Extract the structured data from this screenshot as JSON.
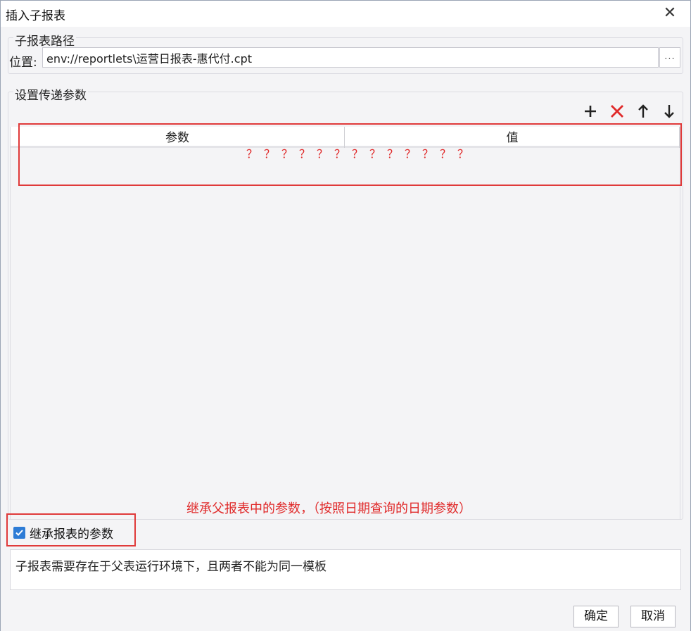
{
  "window": {
    "title": "插入子报表",
    "close_glyph": "✕"
  },
  "path_group": {
    "legend": "子报表路径",
    "label": "位置:",
    "value": "env://reportlets\\运营日报表-惠代付.cpt",
    "browse_label": "..."
  },
  "params_group": {
    "legend": "设置传递参数",
    "toolbar": {
      "add_icon": "plus-icon",
      "delete_icon": "delete-icon",
      "up_icon": "arrow-up-icon",
      "down_icon": "arrow-down-icon",
      "delete_color": "#e02a2a"
    },
    "columns": [
      "参数",
      "值"
    ],
    "annotation_marks": "？？？？？？？？？？？？？"
  },
  "annotation_note": "继承父报表中的参数，（按照日期查询的日期参数）",
  "inherit": {
    "label": "继承报表的参数",
    "checked": true,
    "accent": "#2e7cd6"
  },
  "hint_text": "子报表需要存在于父表运行环境下，且两者不能为同一模板",
  "buttons": {
    "ok": "确定",
    "cancel": "取消"
  },
  "highlight_color": "#e03a3a"
}
